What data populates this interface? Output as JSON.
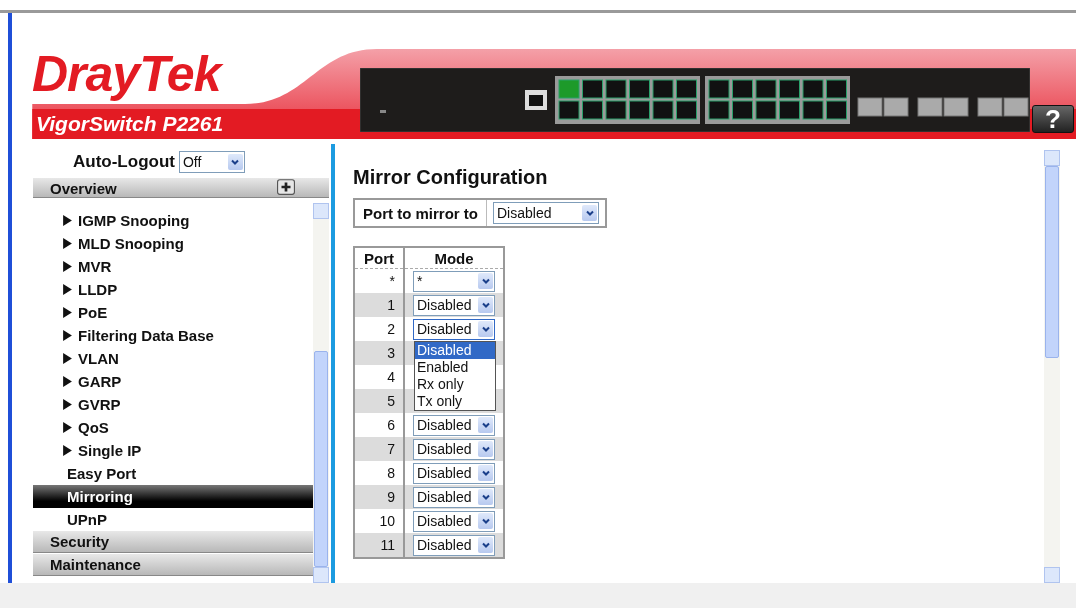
{
  "header": {
    "brand": "DrayTek",
    "model": "VigorSwitch P2261",
    "help": "?"
  },
  "sidebar": {
    "auto_logout": {
      "label": "Auto-Logout",
      "value": "Off"
    },
    "overview": {
      "label": "Overview"
    },
    "items": [
      {
        "label": "IGMP Snooping",
        "kind": "folder",
        "selected": false
      },
      {
        "label": "MLD Snooping",
        "kind": "folder",
        "selected": false
      },
      {
        "label": "MVR",
        "kind": "folder",
        "selected": false
      },
      {
        "label": "LLDP",
        "kind": "folder",
        "selected": false
      },
      {
        "label": "PoE",
        "kind": "folder",
        "selected": false
      },
      {
        "label": "Filtering Data Base",
        "kind": "folder",
        "selected": false
      },
      {
        "label": "VLAN",
        "kind": "folder",
        "selected": false
      },
      {
        "label": "GARP",
        "kind": "folder",
        "selected": false
      },
      {
        "label": "GVRP",
        "kind": "folder",
        "selected": false
      },
      {
        "label": "QoS",
        "kind": "folder",
        "selected": false
      },
      {
        "label": "Single IP",
        "kind": "folder",
        "selected": false
      },
      {
        "label": "Easy Port",
        "kind": "page",
        "selected": false
      },
      {
        "label": "Mirroring",
        "kind": "page",
        "selected": true
      },
      {
        "label": "UPnP",
        "kind": "page",
        "selected": false
      }
    ],
    "sections": [
      "Security",
      "Maintenance"
    ]
  },
  "main": {
    "title": "Mirror Configuration",
    "mirror_port": {
      "label": "Port to mirror to",
      "value": "Disabled"
    },
    "table": {
      "columns": [
        "Port",
        "Mode"
      ],
      "rows": [
        {
          "port": "*",
          "mode": "*",
          "open": false
        },
        {
          "port": "1",
          "mode": "Disabled",
          "open": false
        },
        {
          "port": "2",
          "mode": "Disabled",
          "open": true
        },
        {
          "port": "3"
        },
        {
          "port": "4"
        },
        {
          "port": "5"
        },
        {
          "port": "6",
          "mode": "Disabled",
          "open": false
        },
        {
          "port": "7",
          "mode": "Disabled",
          "open": false
        },
        {
          "port": "8",
          "mode": "Disabled",
          "open": false
        },
        {
          "port": "9",
          "mode": "Disabled",
          "open": false
        },
        {
          "port": "10",
          "mode": "Disabled",
          "open": false
        },
        {
          "port": "11",
          "mode": "Disabled",
          "open": false
        }
      ]
    },
    "dropdown_options": [
      {
        "label": "Disabled",
        "selected": true
      },
      {
        "label": "Enabled",
        "selected": false
      },
      {
        "label": "Rx only",
        "selected": false
      },
      {
        "label": "Tx only",
        "selected": false
      }
    ]
  }
}
